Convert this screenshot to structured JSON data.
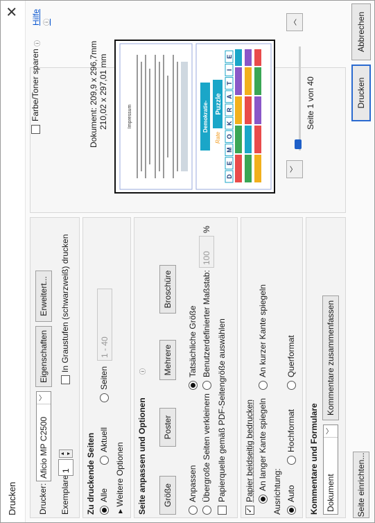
{
  "dialog": {
    "title": "Drucken",
    "help": "Hilfe"
  },
  "printer": {
    "label": "Drucker:",
    "value": "Aficio MP C2500",
    "properties": "Eigenschaften",
    "advanced": "Erweitert...",
    "copies_label": "Exemplare:",
    "copies_value": "1",
    "grayscale": "In Graustufen (schwarzweiß) drucken",
    "save_toner": "Farbe/Toner sparen"
  },
  "pages": {
    "heading": "Zu druckende Seiten",
    "all": "Alle",
    "current": "Aktuell",
    "pages": "Seiten",
    "range": "1 - 40",
    "more": "Weitere Optionen"
  },
  "sizing": {
    "heading": "Seite anpassen und Optionen",
    "tabs": [
      "Größe",
      "Poster",
      "Mehrere",
      "Broschüre"
    ],
    "fit": "Anpassen",
    "actual": "Tatsächliche Größe",
    "shrink": "Übergroße Seiten verkleinern",
    "custom": "Benutzerdefinierter Maßstab:",
    "scale": "100",
    "percent": "%",
    "pdf_paper": "Papierquelle gemäß PDF-Seitengröße auswählen",
    "duplex": "Papier beidseitig bedrucken",
    "long_edge": "An langer Kante spiegeln",
    "short_edge": "An kurzer Kante spiegeln",
    "orientation_label": "Ausrichtung:",
    "auto": "Auto",
    "portrait": "Hochformat",
    "landscape": "Querformat"
  },
  "comments": {
    "heading": "Kommentare und Formulare",
    "value": "Dokument",
    "summarize": "Kommentare zusammenfassen"
  },
  "preview": {
    "doc_size": "Dokument: 209,9 x 296,7mm",
    "doc_size2": "210,02 x 297,01 mm",
    "page_of": "Seite 1 von 40",
    "left_page_title": "Impressum",
    "right_title": "Demokratie-",
    "right_rate": "Rate",
    "right_puzzle": "Puzzle",
    "letters": [
      "D",
      "E",
      "M",
      "O",
      "K",
      "R",
      "A",
      "T",
      "I",
      "E"
    ]
  },
  "footer": {
    "page_setup": "Seite einrichten...",
    "print": "Drucken",
    "cancel": "Abbrechen"
  },
  "colors": {
    "accent": "#1e5fc8",
    "cyan": "#1aa6c8",
    "orange": "#f29a1c"
  }
}
